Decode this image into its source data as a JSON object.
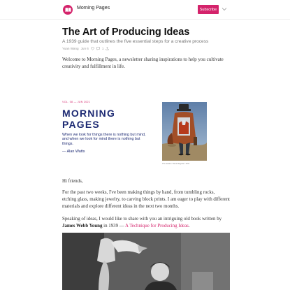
{
  "header": {
    "publication_name": "Morning Pages",
    "subscribe_label": "Subscribe",
    "brand_color": "#d4236b"
  },
  "post": {
    "title": "The Art of Producing Ideas",
    "subtitle": "A 1939 guide that outlines the five essential steps for a creative process",
    "author": "Yuan Wang",
    "date": "Jun 6",
    "comment_count": "1",
    "intro": "Welcome to Morning Pages, a newsletter sharing inspirations to help you cultivate creativity and fulfillment in life."
  },
  "hero": {
    "volume_line": "VOL. 08 — JUN 2021",
    "masthead_line1": "MORNING",
    "masthead_line2": "PAGES",
    "quote": "When we look for things there is nothing but mind, and when we look for mind there is nothing but things.",
    "quote_author": "— Alan Watts",
    "painting_caption": "The Healer / René Magritte / 1937",
    "accent_color": "#1d2a73"
  },
  "body": {
    "greeting": "Hi friends,",
    "para1": "For the past two weeks, I've been making things by hand, from tumbling rocks, etching glass, making jewelry, to carving block prints. I am eager to play with different materials and explore different ideas in the next two months.",
    "para2_prefix": "Speaking of ideas, I would like to share with you an intriguing old book written by",
    "book_author": "James Webb Young",
    "para2_middle": "in 1939 —",
    "book_title": "A Technique for Producing Ideas",
    "para2_suffix": "."
  }
}
